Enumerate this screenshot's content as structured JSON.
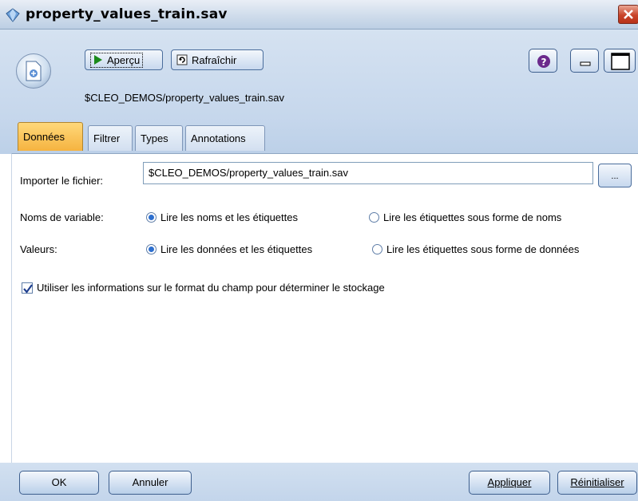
{
  "window": {
    "title": "property_values_train.sav"
  },
  "toolbar": {
    "preview_label": "Aperçu",
    "refresh_label": "Rafraîchir",
    "path": "$CLEO_DEMOS/property_values_train.sav"
  },
  "tabs": [
    {
      "label": "Données",
      "active": true
    },
    {
      "label": "Filtrer"
    },
    {
      "label": "Types"
    },
    {
      "label": "Annotations"
    }
  ],
  "form": {
    "import_label": "Importer le fichier:",
    "import_value": "$CLEO_DEMOS/property_values_train.sav",
    "browse_label": "...",
    "variable_names_label": "Noms de variable:",
    "variable_names_opt1": "Lire les noms et les étiquettes",
    "variable_names_opt2": "Lire les étiquettes sous forme de noms",
    "values_label": "Valeurs:",
    "values_opt1": "Lire les données et les étiquettes",
    "values_opt2": "Lire les étiquettes sous forme de données",
    "format_checkbox_label": "Utiliser les informations sur le format du champ pour déterminer le stockage"
  },
  "buttons": {
    "ok": "OK",
    "cancel": "Annuler",
    "apply": "Appliquer",
    "reset": "Réinitialiser"
  },
  "colors": {
    "active_tab": "#f5b340",
    "accent": "#2d6fcf",
    "close": "#c9442a"
  }
}
